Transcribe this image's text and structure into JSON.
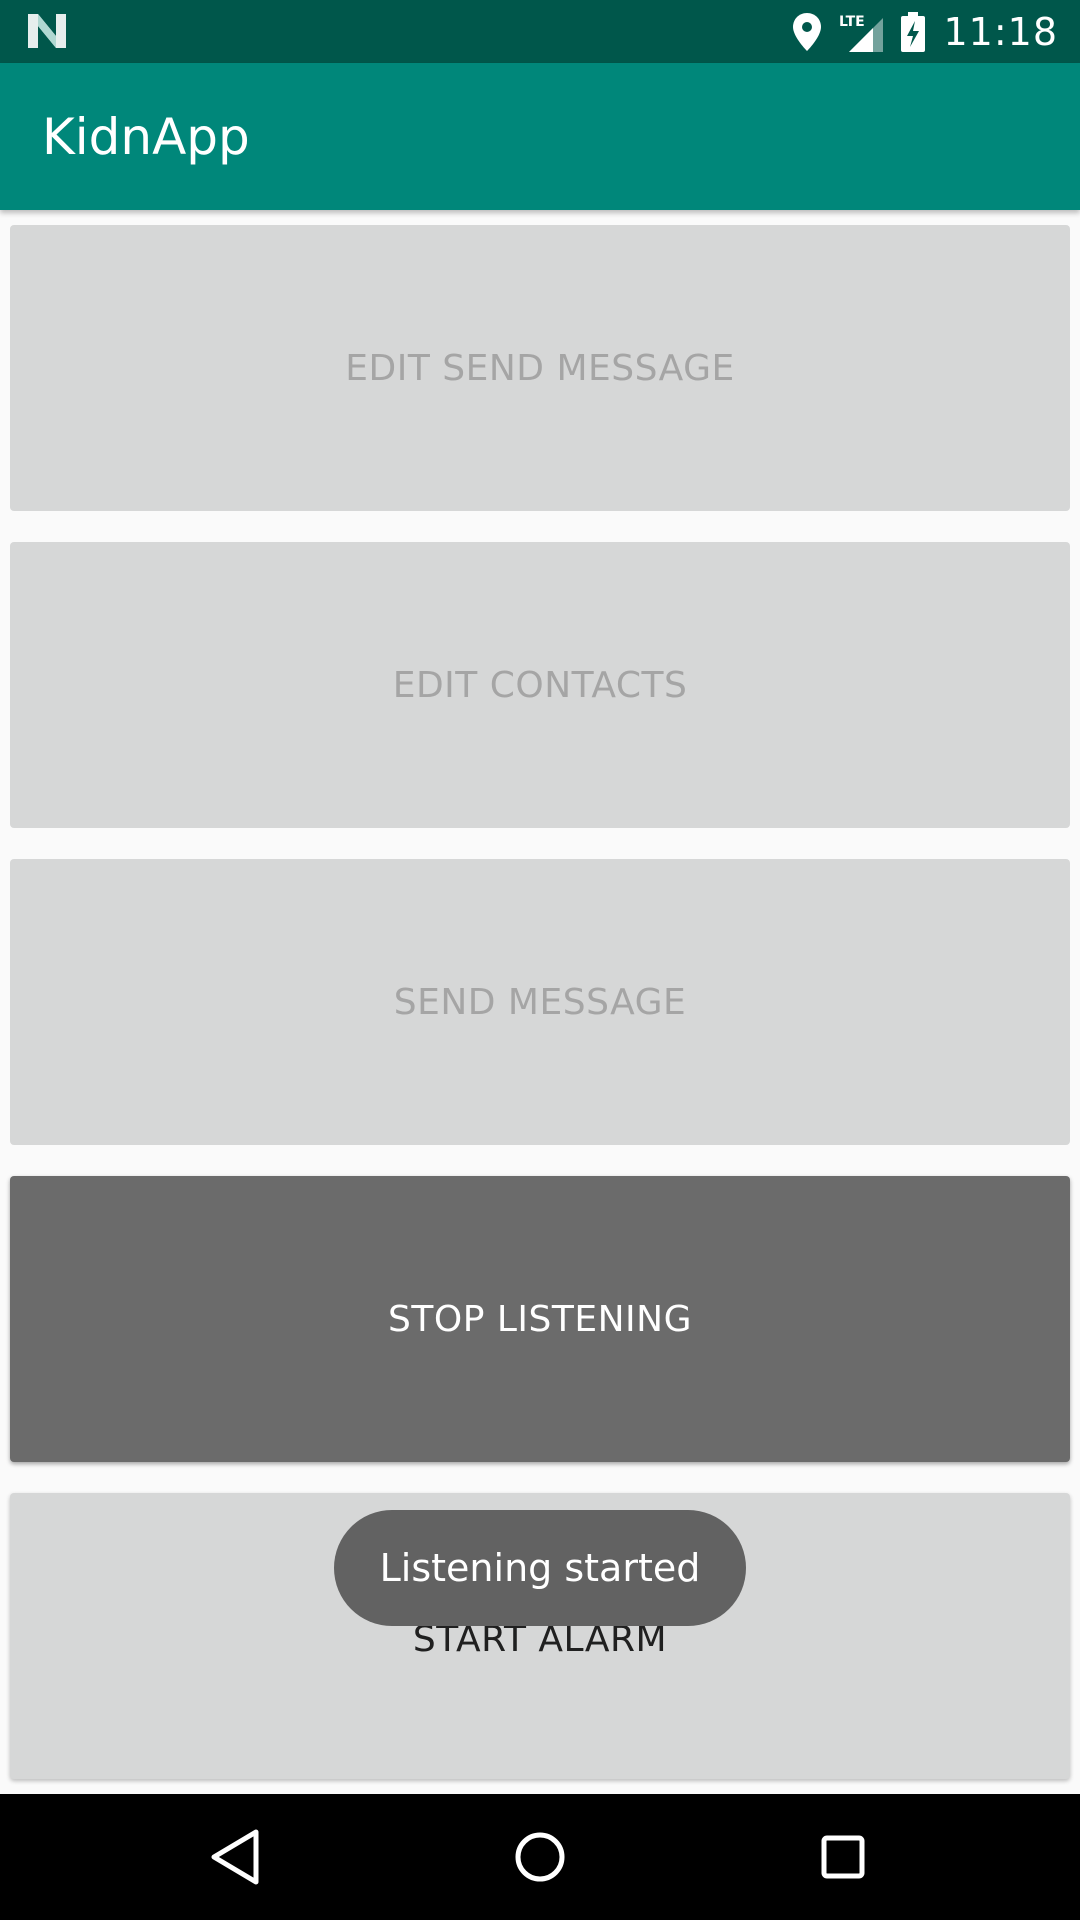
{
  "status_bar": {
    "time": "11:18",
    "network_label": "LTE",
    "icons": [
      "n-logo-icon",
      "location-icon",
      "signal-icon",
      "battery-charging-icon"
    ]
  },
  "app_bar": {
    "title": "KidnApp"
  },
  "buttons": [
    {
      "label": "EDIT SEND MESSAGE",
      "state": "disabled"
    },
    {
      "label": "EDIT CONTACTS",
      "state": "disabled"
    },
    {
      "label": "SEND MESSAGE",
      "state": "disabled"
    },
    {
      "label": "STOP LISTENING",
      "state": "active"
    },
    {
      "label": "START ALARM",
      "state": "normal"
    }
  ],
  "toast": {
    "text": "Listening started"
  },
  "nav_bar": {
    "icons": [
      "back-icon",
      "home-icon",
      "recents-icon"
    ]
  },
  "colors": {
    "status_bar": "#00574b",
    "app_bar": "#00877a",
    "button_disabled": "#d6d7d7",
    "button_active": "#6b6b6b",
    "toast": "#626262"
  }
}
